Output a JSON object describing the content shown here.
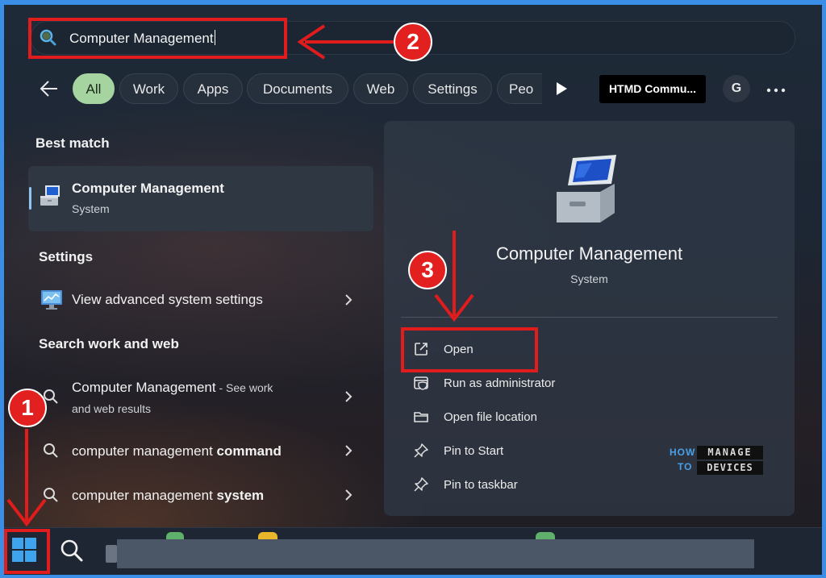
{
  "search": {
    "query": "Computer Management"
  },
  "filters": {
    "items": [
      {
        "label": "All",
        "active": true
      },
      {
        "label": "Work"
      },
      {
        "label": "Apps"
      },
      {
        "label": "Documents"
      },
      {
        "label": "Web"
      },
      {
        "label": "Settings"
      },
      {
        "label": "Peo"
      }
    ],
    "org_label": "HTMD Commu...",
    "account_initial": "G"
  },
  "best_match": {
    "heading": "Best match",
    "title": "Computer Management",
    "subtitle": "System"
  },
  "settings": {
    "heading": "Settings",
    "items": [
      {
        "label": "View advanced system settings"
      }
    ]
  },
  "web": {
    "heading": "Search work and web",
    "items": [
      {
        "prefix": "Computer Management",
        "suffix": " - See work",
        "line2": "and web results"
      },
      {
        "plain": "computer management ",
        "bold": "command"
      },
      {
        "plain": "computer management ",
        "bold": "system"
      }
    ]
  },
  "details": {
    "title": "Computer Management",
    "subtitle": "System",
    "actions": [
      {
        "label": "Open",
        "icon": "open-external-icon"
      },
      {
        "label": "Run as administrator",
        "icon": "shield-icon"
      },
      {
        "label": "Open file location",
        "icon": "folder-icon"
      },
      {
        "label": "Pin to Start",
        "icon": "pin-icon"
      },
      {
        "label": "Pin to taskbar",
        "icon": "pin-icon"
      }
    ]
  },
  "annotations": {
    "step1": "1",
    "step2": "2",
    "step3": "3"
  },
  "watermark": {
    "how": "HOW",
    "to": "TO",
    "manage": "MANAGE",
    "devices": "DEVICES"
  },
  "colors": {
    "frame": "#3a8ee6",
    "annotation_red": "#e01c1c",
    "active_chip": "#a6d4a0"
  }
}
